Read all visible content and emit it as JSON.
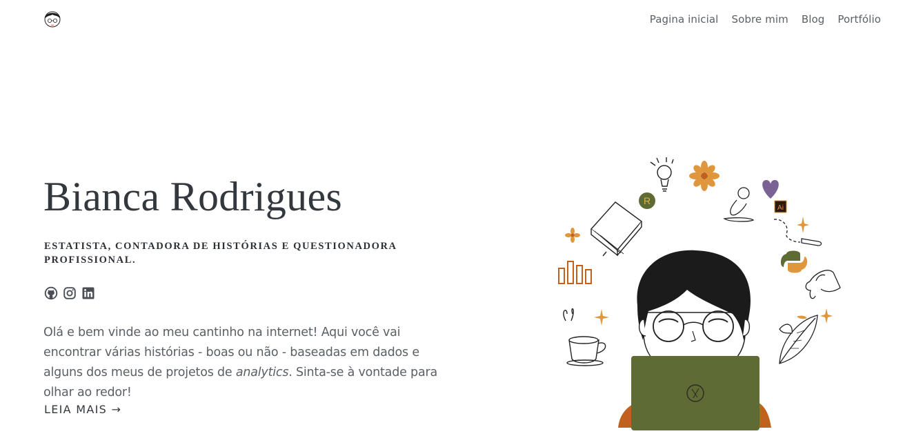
{
  "header": {
    "logo_icon": "avatar-logo-icon",
    "nav": [
      {
        "label": "Pagina inicial"
      },
      {
        "label": "Sobre mim"
      },
      {
        "label": "Blog"
      },
      {
        "label": "Portfólio"
      }
    ]
  },
  "hero": {
    "name": "Bianca Rodrigues",
    "tagline": "ESTATISTA, CONTADORA DE HISTÓRIAS E QUESTIONADORA PROFISSIONAL.",
    "social_icons": [
      "github-icon",
      "instagram-icon",
      "linkedin-icon"
    ],
    "intro_part1": "Olá e bem vinde ao meu cantinho na internet! Aqui você vai encontrar várias histórias - boas ou não - baseadas em dados e alguns dos meus de projetos de ",
    "intro_em": "analytics",
    "intro_part2": ". Sinta-se à vontade para olhar ao redor!",
    "read_more": "LEIA MAIS →"
  },
  "illustration": {
    "r_badge": "R",
    "ai_badge": "Ai",
    "colors": {
      "laptop": "#5e6b35",
      "orange": "#e0963d",
      "rust": "#c0621d",
      "purple": "#7a6394",
      "hair": "#1b1b1b"
    }
  }
}
